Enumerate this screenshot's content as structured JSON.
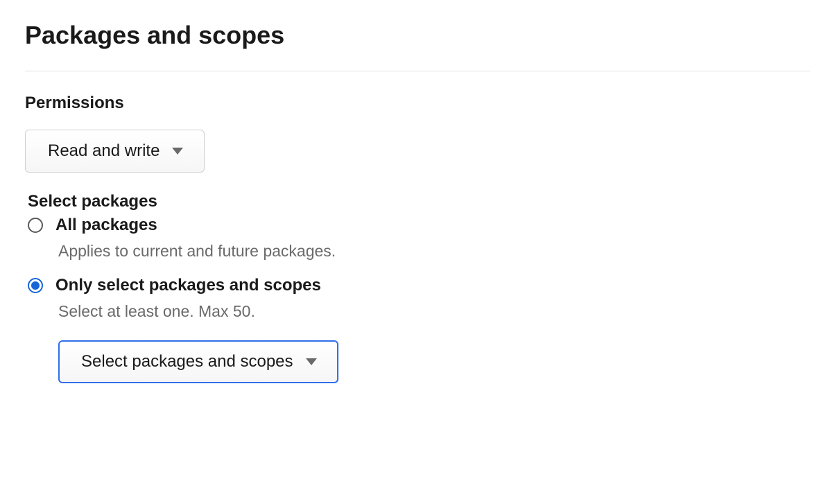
{
  "page": {
    "title": "Packages and scopes"
  },
  "permissions": {
    "label": "Permissions",
    "dropdown_value": "Read and write"
  },
  "select_packages": {
    "label": "Select packages",
    "options": [
      {
        "label": "All packages",
        "hint": "Applies to current and future packages.",
        "checked": false
      },
      {
        "label": "Only select packages and scopes",
        "hint": "Select at least one. Max 50.",
        "checked": true
      }
    ],
    "nested_dropdown_value": "Select packages and scopes"
  }
}
